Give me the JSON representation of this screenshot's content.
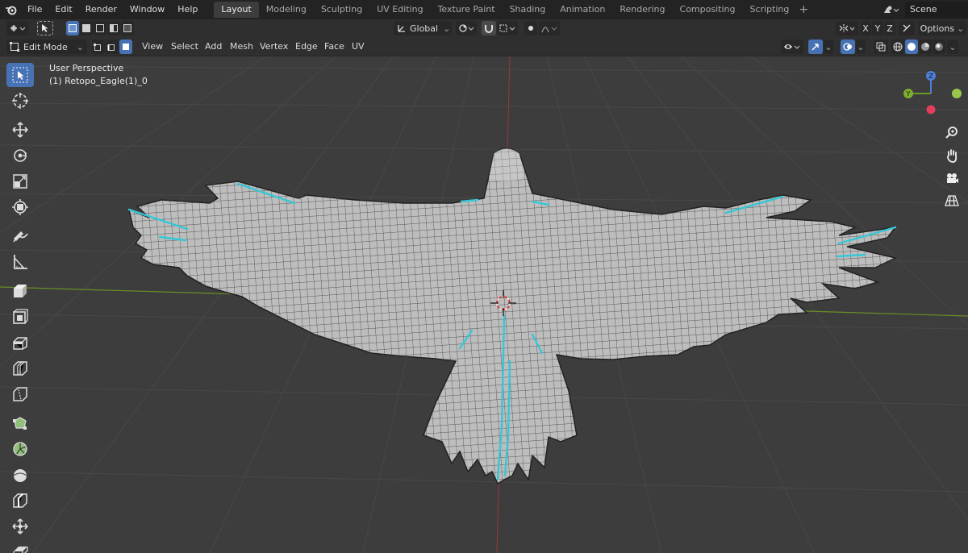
{
  "menus": [
    "File",
    "Edit",
    "Render",
    "Window",
    "Help"
  ],
  "workspaces": [
    {
      "label": "Layout",
      "active": true
    },
    {
      "label": "Modeling",
      "active": false
    },
    {
      "label": "Sculpting",
      "active": false
    },
    {
      "label": "UV Editing",
      "active": false
    },
    {
      "label": "Texture Paint",
      "active": false
    },
    {
      "label": "Shading",
      "active": false
    },
    {
      "label": "Animation",
      "active": false
    },
    {
      "label": "Rendering",
      "active": false
    },
    {
      "label": "Compositing",
      "active": false
    },
    {
      "label": "Scripting",
      "active": false
    }
  ],
  "scene": "Scene",
  "header": {
    "orientation": "Global",
    "options": "Options",
    "axes": [
      "X",
      "Y",
      "Z"
    ],
    "mode": "Edit Mode",
    "menus": [
      "View",
      "Select",
      "Add",
      "Mesh",
      "Vertex",
      "Edge",
      "Face",
      "UV"
    ]
  },
  "viewport": {
    "perspective": "User Perspective",
    "object": "(1) Retopo_Eagle(1)_0",
    "gizmo_axes": {
      "z": "Z",
      "y": "Y"
    },
    "colors": {
      "background": "#3d3d3d",
      "grid": "#4a4a4a",
      "x_axis": "#7a3338",
      "y_axis": "#6a8f26",
      "mesh": "#b9b9b9",
      "seam": "#36c7d6",
      "accent": "#4772b3"
    }
  },
  "tools": [
    "select-box",
    "cursor",
    "move",
    "rotate",
    "scale",
    "transform",
    "annotate",
    "measure",
    "extrude",
    "inset",
    "bevel",
    "loop-cut",
    "knife",
    "poly-build",
    "spin",
    "smooth",
    "edge-slide",
    "shrink-fatten",
    "shear"
  ]
}
